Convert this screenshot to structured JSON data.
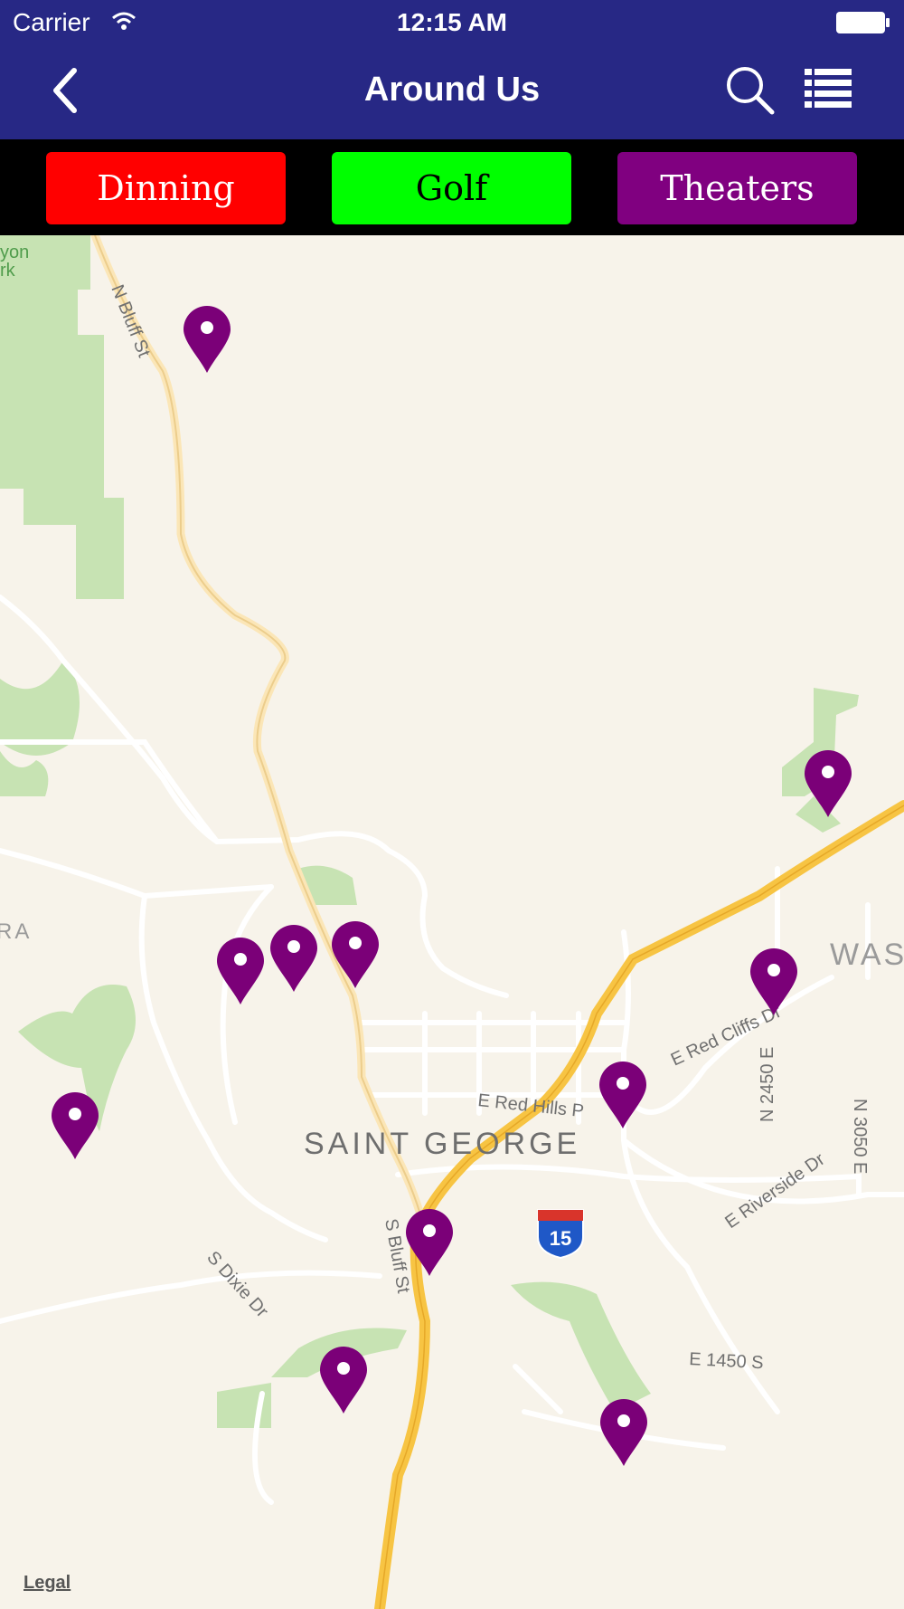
{
  "status": {
    "carrier": "Carrier",
    "time": "12:15 AM"
  },
  "nav": {
    "title": "Around Us"
  },
  "filters": [
    {
      "label": "Dinning",
      "bg": "#ff0000",
      "fg": "#ffffff"
    },
    {
      "label": "Golf",
      "bg": "#00ff00",
      "fg": "#000000"
    },
    {
      "label": "Theaters",
      "bg": "#800080",
      "fg": "#ffffff"
    }
  ],
  "map": {
    "pin_color": "#7b0078",
    "city_label": "SAINT GEORGE",
    "labels": {
      "n_bluff": "N Bluff St",
      "s_bluff": "S Bluff St",
      "s_dixie": "S Dixie Dr",
      "red_hills": "E Red Hills P",
      "red_cliffs": "E Red Cliffs Dr",
      "riverside": "E Riverside Dr",
      "e1450": "E 1450 S",
      "n2450": "N 2450 E",
      "n3050": "N 3050 E",
      "was": "WAS",
      "ra": "RA",
      "yon": "yon",
      "rk": "rk",
      "interstate": "15"
    },
    "legal": "Legal"
  }
}
